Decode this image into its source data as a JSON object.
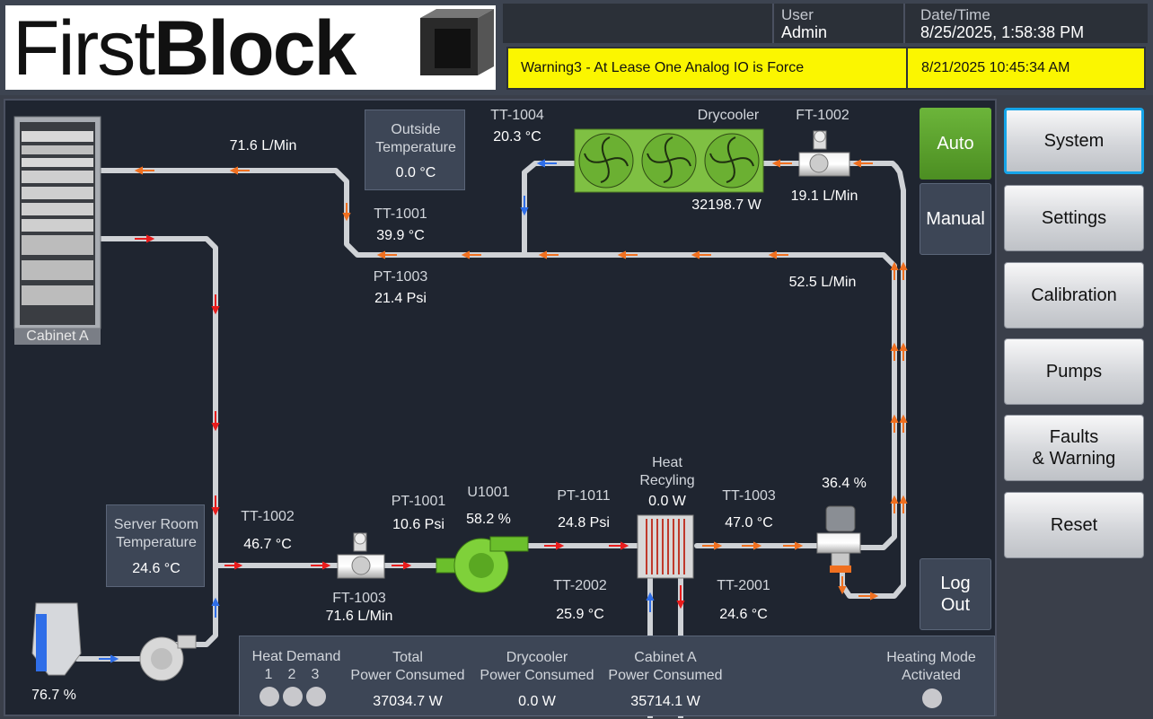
{
  "header": {
    "logo_text_thin": "First",
    "logo_text_bold": "Block",
    "user_label": "User",
    "user_value": "Admin",
    "datetime_label": "Date/Time",
    "datetime_value": "8/25/2025, 1:58:38 PM",
    "alarm_message": "Warning3 - At Lease One Analog IO is Force",
    "alarm_time": "8/21/2025 10:45:34 AM",
    "alarm_color": "#fbf600"
  },
  "nav": {
    "items": [
      {
        "label": "System",
        "active": true
      },
      {
        "label": "Settings",
        "active": false
      },
      {
        "label": "Calibration",
        "active": false
      },
      {
        "label": "Pumps",
        "active": false
      },
      {
        "label": "Faults\n& Warning",
        "active": false
      },
      {
        "label": "Reset",
        "active": false
      }
    ]
  },
  "mode": {
    "auto_label": "Auto",
    "manual_label": "Manual",
    "logout_label": "Log\nOut",
    "auto_color": "#5aa02c"
  },
  "diagram": {
    "cabinet_label": "Cabinet A",
    "flow_return": "71.6 L/Min",
    "outside_temp_label": "Outside\nTemperature",
    "outside_temp_value": "0.0 °C",
    "tt1004_label": "TT-1004",
    "tt1004_value": "20.3 °C",
    "drycooler_label": "Drycooler",
    "drycooler_power": "32198.7 W",
    "ft1002_label": "FT-1002",
    "ft1002_value": "19.1 L/Min",
    "tt1001_label": "TT-1001",
    "tt1001_value": "39.9 °C",
    "pt1003_label": "PT-1003",
    "pt1003_value": "21.4 Psi",
    "bypass_flow": "52.5 L/Min",
    "server_room_label": "Server Room\nTemperature",
    "server_room_value": "24.6 °C",
    "tt1002_label": "TT-1002",
    "tt1002_value": "46.7 °C",
    "pt1001_label": "PT-1001",
    "pt1001_value": "10.6 Psi",
    "u1001_label": "U1001",
    "u1001_value": "58.2 %",
    "ft1003_label": "FT-1003",
    "ft1003_value": "71.6 L/Min",
    "pt1011_label": "PT-1011",
    "pt1011_value": "24.8 Psi",
    "heat_label": "Heat\nRecyling",
    "heat_value": "0.0 W",
    "tt1003_label": "TT-1003",
    "tt1003_value": "47.0 °C",
    "valve_value": "36.4 %",
    "tt2002_label": "TT-2002",
    "tt2002_value": "25.9 °C",
    "tt2001_label": "TT-2001",
    "tt2001_value": "24.6 °C",
    "tank_level": "76.7 %",
    "tank_level_fraction": 0.767
  },
  "summary": {
    "heat_demand_label": "Heat Demand",
    "heat_demand_nums": [
      "1",
      "2",
      "3"
    ],
    "total_label": "Total\nPower Consumed",
    "total_value": "37034.7 W",
    "drycooler_label": "Drycooler\nPower Consumed",
    "drycooler_value": "0.0 W",
    "cabinet_label": "Cabinet A\nPower Consumed",
    "cabinet_value": "35714.1 W",
    "heating_mode_label": "Heating Mode\nActivated"
  }
}
